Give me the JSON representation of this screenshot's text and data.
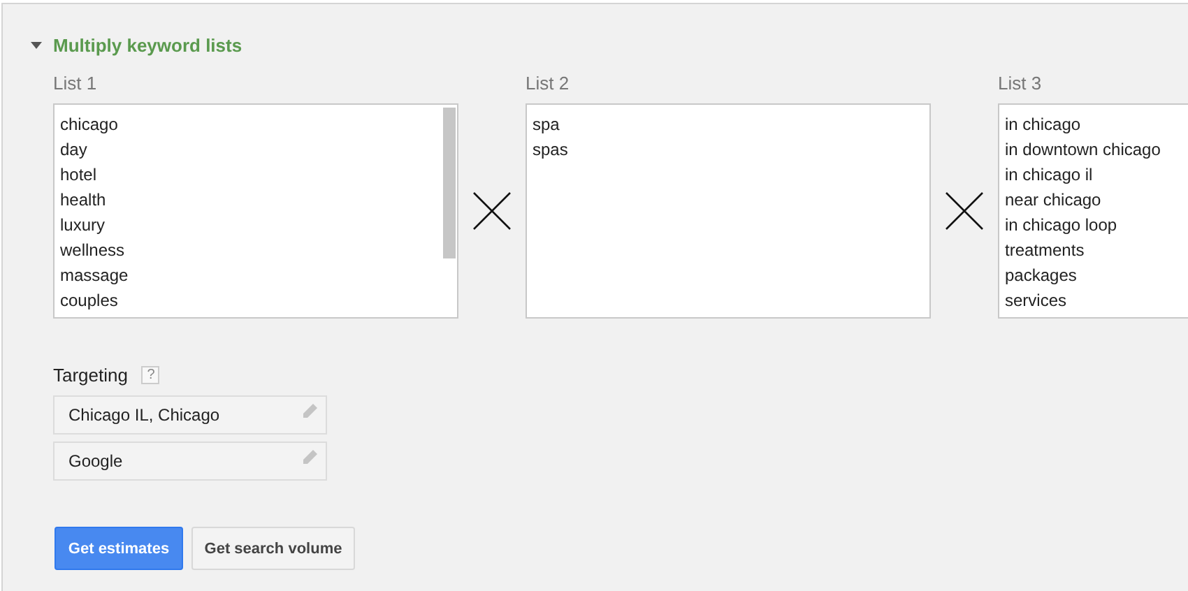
{
  "section": {
    "title": "Multiply keyword lists",
    "expanded": true
  },
  "lists": [
    {
      "label": "List 1",
      "items": [
        "chicago",
        "day",
        "hotel",
        "health",
        "luxury",
        "wellness",
        "massage",
        "couples"
      ],
      "scrollable": true
    },
    {
      "label": "List 2",
      "items": [
        "spa",
        "spas"
      ],
      "scrollable": false
    },
    {
      "label": "List 3",
      "items": [
        "in chicago",
        "in downtown chicago",
        "in chicago il",
        "near chicago",
        "in chicago loop",
        "treatments",
        "packages",
        "services"
      ],
      "scrollable": false
    }
  ],
  "targeting": {
    "label": "Targeting",
    "help": "?",
    "items": [
      "Chicago IL, Chicago",
      "Google"
    ]
  },
  "buttons": [
    {
      "label": "Get estimates",
      "kind": "primary"
    },
    {
      "label": "Get search volume",
      "kind": "secondary"
    }
  ]
}
